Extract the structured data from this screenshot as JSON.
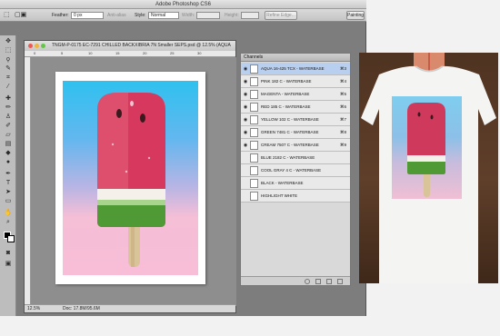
{
  "app": {
    "title": "Adobe Photoshop CS6"
  },
  "options_bar": {
    "feather_label": "Feather:",
    "feather_value": "0 px",
    "antialias_label": "Anti-alias",
    "style_label": "Style:",
    "style_value": "Normal",
    "width_label": "Width:",
    "height_label": "Height:",
    "refine_edge_label": "Refine Edge...",
    "workspace_label": "Painting"
  },
  "document": {
    "tab_title": "TNGM-P-0175 EC-7291 CHILLED BACKXIBRIA 7N Smaller SEPS.psd @ 12.5% (AQUA",
    "zoom": "12.5%",
    "doc_size": "Doc: 17.8M/95.6M",
    "ruler_ticks": [
      "0",
      "5",
      "10",
      "15",
      "20",
      "25",
      "30"
    ]
  },
  "channels_panel": {
    "tab_label": "Channels",
    "channels": [
      {
        "name": "AQUA 16-425 TCX - WATERBASE",
        "shortcut": "⌘3",
        "selected": true
      },
      {
        "name": "PINK 182 C - WATERBASE",
        "shortcut": "⌘4",
        "selected": false
      },
      {
        "name": "MAGENTA - WATERBASE",
        "shortcut": "⌘5",
        "selected": false
      },
      {
        "name": "RED 185 C - WATERBASE",
        "shortcut": "⌘6",
        "selected": false
      },
      {
        "name": "YELLOW 102 C - WATERBASE",
        "shortcut": "⌘7",
        "selected": false
      },
      {
        "name": "GREEN 7481 C - WATERBASE",
        "shortcut": "⌘8",
        "selected": false
      },
      {
        "name": "CREAM 7507 C - WATERBASE",
        "shortcut": "⌘9",
        "selected": false
      },
      {
        "name": "BLUE 2182 C - WATERBASE",
        "shortcut": "",
        "selected": false
      },
      {
        "name": "COOL GRAY 4 C - WATERBASE",
        "shortcut": "",
        "selected": false
      },
      {
        "name": "BLACK - WATERBASE",
        "shortcut": "",
        "selected": false
      },
      {
        "name": "HIGHLIGHT WHITE",
        "shortcut": "",
        "selected": false
      }
    ]
  },
  "colors": {
    "sky_blue": "#2fc1ef",
    "pink": "#f8bdd7",
    "watermelon_red": "#d7385d",
    "rind_green": "#4f9a35",
    "selection_blue": "#b8cff0"
  }
}
